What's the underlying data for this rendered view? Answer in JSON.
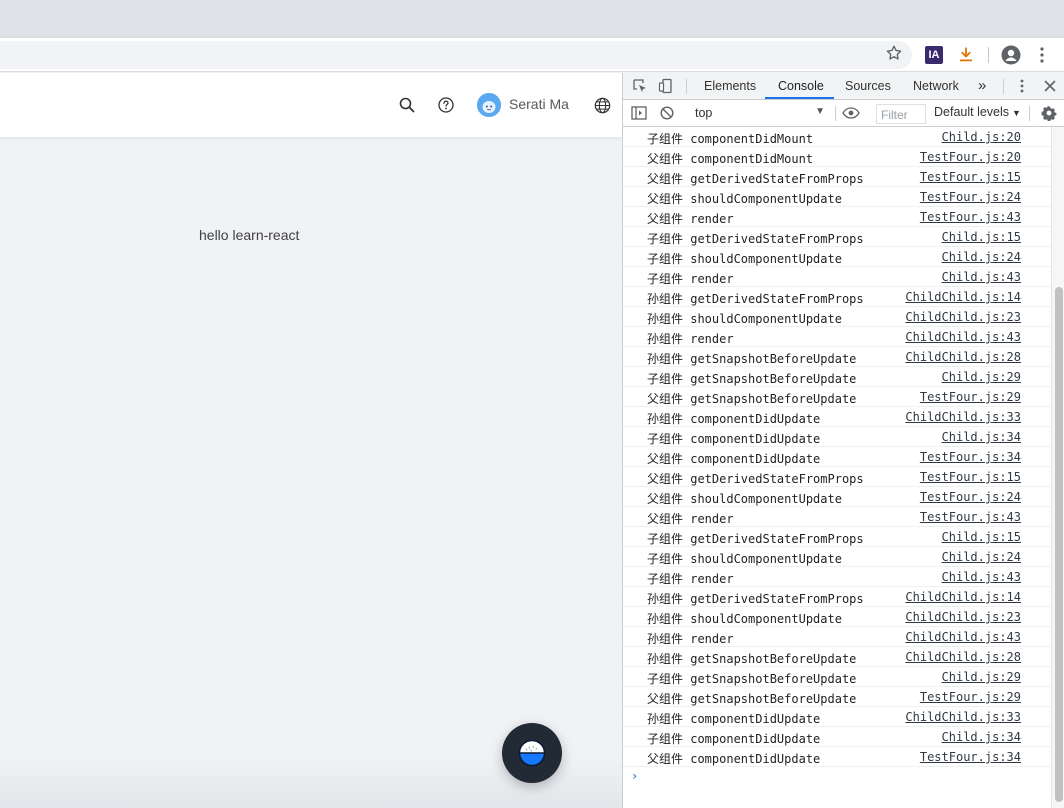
{
  "browser": {
    "extensions": [
      {
        "name": "ia-extension-icon",
        "label": "IA"
      },
      {
        "name": "download-icon",
        "label": ""
      }
    ],
    "colors": {
      "ia_bg": "#3b2a6e",
      "download": "#e37400"
    }
  },
  "app": {
    "header": {
      "user_name": "Serati Ma"
    },
    "content_text": "hello learn-react",
    "colors": {
      "avatar": "#5aa9f0",
      "fab": "#222a35",
      "fab_accent": "#1677ff"
    }
  },
  "devtools": {
    "tabs": [
      {
        "label": "Elements",
        "active": false
      },
      {
        "label": "Console",
        "active": true
      },
      {
        "label": "Sources",
        "active": false
      },
      {
        "label": "Network",
        "active": false
      }
    ],
    "more_tabs": "»",
    "context": "top",
    "filter_placeholder": "Filter",
    "levels": "Default levels",
    "logs": [
      {
        "msg": "子组件 componentDidMount",
        "src": "Child.js:20"
      },
      {
        "msg": "父组件 componentDidMount",
        "src": "TestFour.js:20"
      },
      {
        "msg": "父组件 getDerivedStateFromProps",
        "src": "TestFour.js:15"
      },
      {
        "msg": "父组件 shouldComponentUpdate",
        "src": "TestFour.js:24"
      },
      {
        "msg": "父组件 render",
        "src": "TestFour.js:43"
      },
      {
        "msg": "子组件 getDerivedStateFromProps",
        "src": "Child.js:15"
      },
      {
        "msg": "子组件 shouldComponentUpdate",
        "src": "Child.js:24"
      },
      {
        "msg": "子组件 render",
        "src": "Child.js:43"
      },
      {
        "msg": "孙组件 getDerivedStateFromProps",
        "src": "ChildChild.js:14"
      },
      {
        "msg": "孙组件 shouldComponentUpdate",
        "src": "ChildChild.js:23"
      },
      {
        "msg": "孙组件 render",
        "src": "ChildChild.js:43"
      },
      {
        "msg": "孙组件 getSnapshotBeforeUpdate",
        "src": "ChildChild.js:28"
      },
      {
        "msg": "子组件 getSnapshotBeforeUpdate",
        "src": "Child.js:29"
      },
      {
        "msg": "父组件 getSnapshotBeforeUpdate",
        "src": "TestFour.js:29"
      },
      {
        "msg": "孙组件 componentDidUpdate",
        "src": "ChildChild.js:33"
      },
      {
        "msg": "子组件 componentDidUpdate",
        "src": "Child.js:34"
      },
      {
        "msg": "父组件 componentDidUpdate",
        "src": "TestFour.js:34"
      },
      {
        "msg": "父组件 getDerivedStateFromProps",
        "src": "TestFour.js:15"
      },
      {
        "msg": "父组件 shouldComponentUpdate",
        "src": "TestFour.js:24"
      },
      {
        "msg": "父组件 render",
        "src": "TestFour.js:43"
      },
      {
        "msg": "子组件 getDerivedStateFromProps",
        "src": "Child.js:15"
      },
      {
        "msg": "子组件 shouldComponentUpdate",
        "src": "Child.js:24"
      },
      {
        "msg": "子组件 render",
        "src": "Child.js:43"
      },
      {
        "msg": "孙组件 getDerivedStateFromProps",
        "src": "ChildChild.js:14"
      },
      {
        "msg": "孙组件 shouldComponentUpdate",
        "src": "ChildChild.js:23"
      },
      {
        "msg": "孙组件 render",
        "src": "ChildChild.js:43"
      },
      {
        "msg": "孙组件 getSnapshotBeforeUpdate",
        "src": "ChildChild.js:28"
      },
      {
        "msg": "子组件 getSnapshotBeforeUpdate",
        "src": "Child.js:29"
      },
      {
        "msg": "父组件 getSnapshotBeforeUpdate",
        "src": "TestFour.js:29"
      },
      {
        "msg": "孙组件 componentDidUpdate",
        "src": "ChildChild.js:33"
      },
      {
        "msg": "子组件 componentDidUpdate",
        "src": "Child.js:34"
      },
      {
        "msg": "父组件 componentDidUpdate",
        "src": "TestFour.js:34"
      }
    ],
    "prompt_symbol": "›",
    "colors": {
      "active_tab_underline": "#1a73e8"
    }
  }
}
